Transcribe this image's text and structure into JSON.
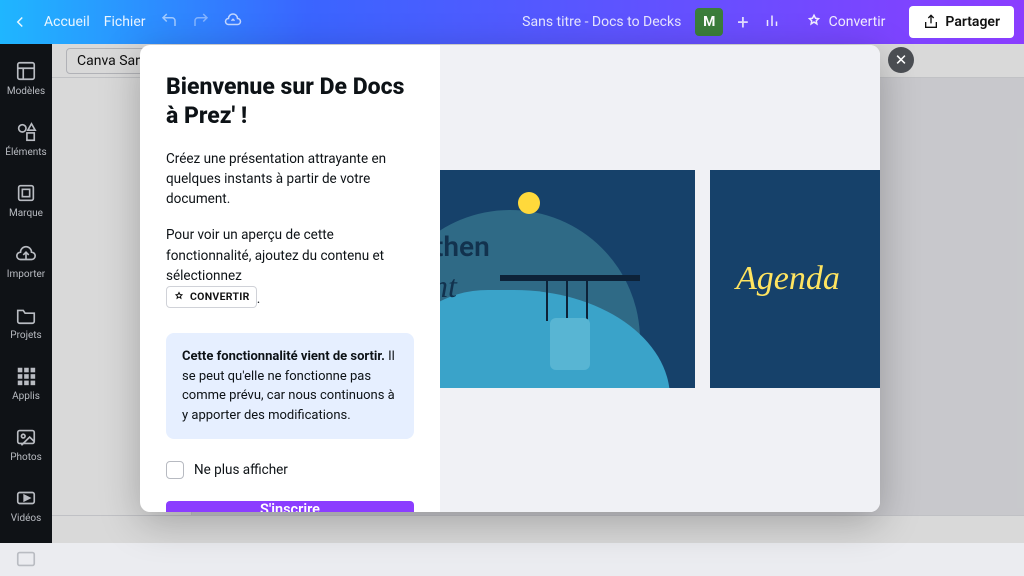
{
  "topbar": {
    "home": "Accueil",
    "file": "Fichier",
    "doc_title": "Sans titre - Docs to Decks",
    "avatar_initial": "M",
    "convert": "Convertir",
    "share": "Partager"
  },
  "sidebar": {
    "items": [
      {
        "label": "Modèles",
        "icon": "templates-icon"
      },
      {
        "label": "Éléments",
        "icon": "elements-icon"
      },
      {
        "label": "Marque",
        "icon": "brand-icon"
      },
      {
        "label": "Importer",
        "icon": "upload-icon"
      },
      {
        "label": "Projets",
        "icon": "folder-icon"
      },
      {
        "label": "Applis",
        "icon": "apps-icon"
      },
      {
        "label": "Photos",
        "icon": "photos-icon"
      },
      {
        "label": "Vidéos",
        "icon": "videos-icon"
      }
    ]
  },
  "toolbar": {
    "font": "Canva Sans"
  },
  "modal": {
    "title": "Bienvenue sur De Docs à Prez' !",
    "p1": "Créez une présentation attrayante en quelques instants à partir de votre document.",
    "p2": "Pour voir un aperçu de cette fonctionnalité, ajoutez du contenu et sélectionnez",
    "convert_pill": "CONVERTIR",
    "p2_tail": ".",
    "callout_strong": "Cette fonctionnalité vient de sortir.",
    "callout_rest": " Il se peut qu'elle ne fonctionne pas comme prévu, car nous continuons à y apporter des modifications.",
    "checkbox_label": "Ne plus afficher",
    "cta": "S'inscrire",
    "slide_a_text1": "then",
    "slide_a_text2": "nt",
    "slide_b_text": "Agenda"
  }
}
